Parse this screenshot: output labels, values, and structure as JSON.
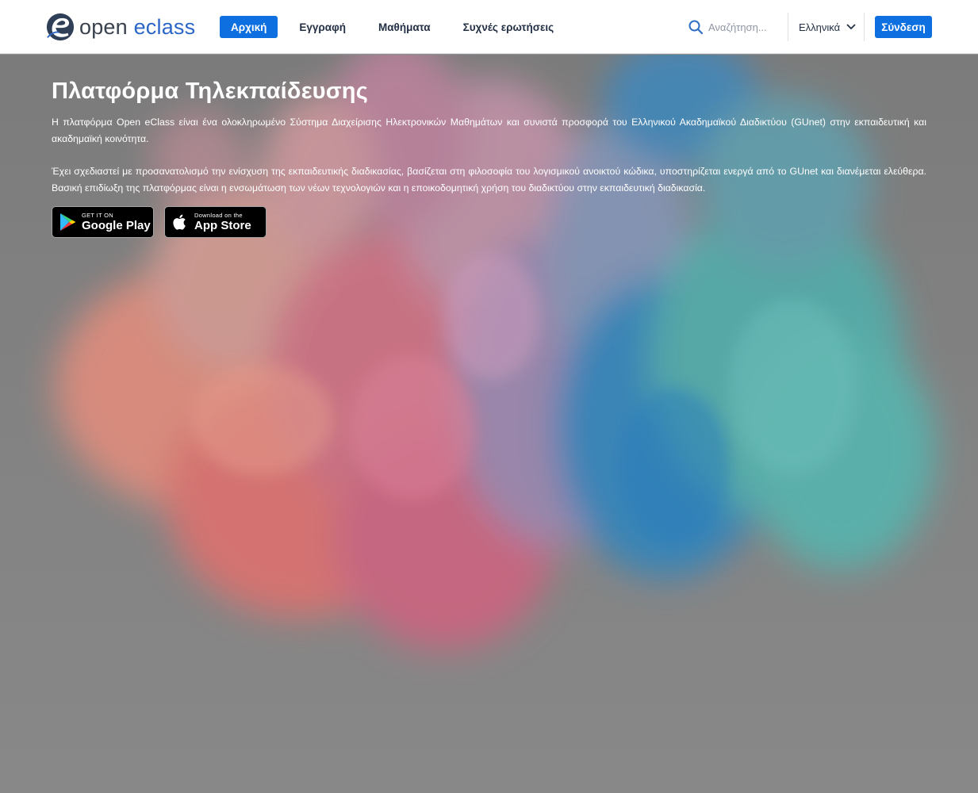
{
  "brand": {
    "logo_word_1": "open ",
    "logo_word_2": "eclass"
  },
  "nav": {
    "items": [
      {
        "label": "Αρχική",
        "active": true
      },
      {
        "label": "Εγγραφή",
        "active": false
      },
      {
        "label": "Μαθήματα",
        "active": false
      },
      {
        "label": "Συχνές ερωτήσεις",
        "active": false
      }
    ]
  },
  "search": {
    "placeholder": "Αναζήτηση..."
  },
  "language": {
    "selected": "Ελληνικά"
  },
  "login": {
    "label": "Σύνδεση"
  },
  "hero": {
    "title": "Πλατφόρμα Τηλεκπαίδευσης",
    "paragraph_1": "Η πλατφόρμα Open eClass είναι ένα ολοκληρωμένο Σύστημα Διαχείρισης Ηλεκτρονικών Μαθημάτων και συνιστά προσφορά του Ελληνικού Ακαδημαϊκού Διαδικτύου (GUnet) στην εκπαιδευτική και ακαδημαϊκή κοινότητα.",
    "paragraph_2": "Έχει σχεδιαστεί με προσανατολισμό την ενίσχυση της εκπαιδευτικής διαδικασίας, βασίζεται στη φιλοσοφία του λογισμικού ανοικτού κώδικα, υποστηρίζεται ενεργά από το GUnet και διανέμεται ελεύθερα. Βασική επιδίωξη της πλατφόρμας είναι η ενσωμάτωση των νέων τεχνολογιών και η εποικοδομητική χρήση του διαδικτύου στην εκπαιδευτική διαδικασία."
  },
  "badges": {
    "google_play": {
      "small": "GET IT ON",
      "big": "Google Play",
      "icon": "google-play-icon"
    },
    "app_store": {
      "small": "Download on the",
      "big": "App Store",
      "icon": "apple-icon"
    }
  },
  "colors": {
    "accent": "#0d6fe0",
    "header_bg": "#ffffff",
    "text_dark": "#233045"
  }
}
